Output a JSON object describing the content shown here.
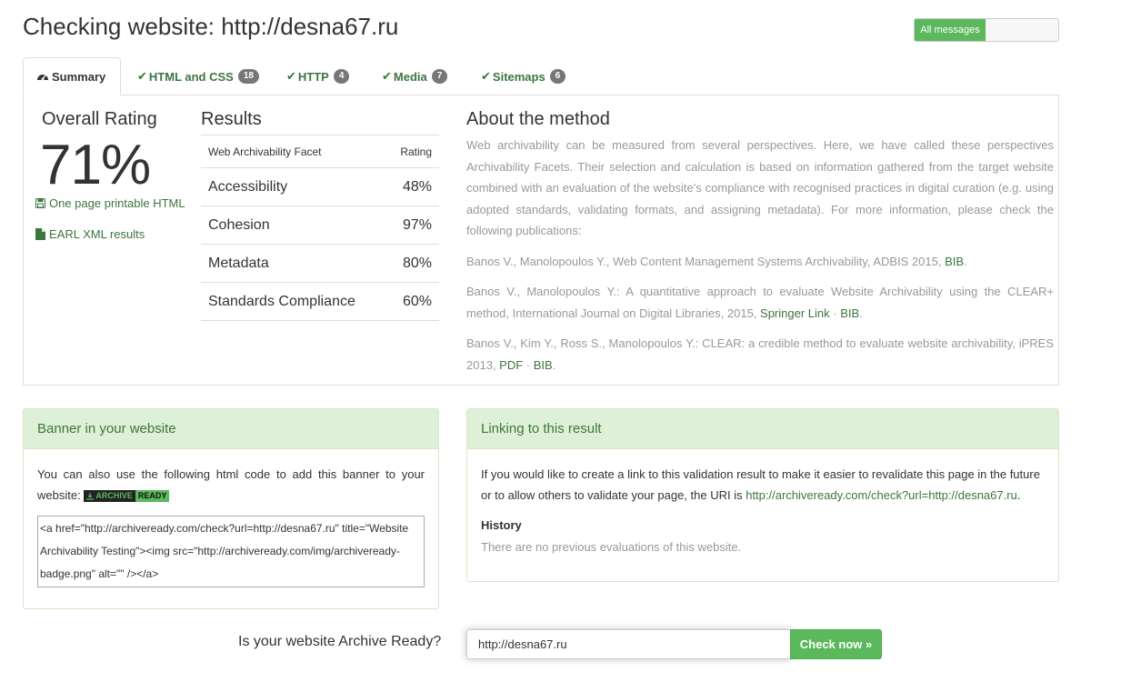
{
  "header": {
    "title": "Checking website: http://desna67.ru",
    "toggle_label": "All messages"
  },
  "tabs": [
    {
      "label": "Summary",
      "icon": "dashboard-icon",
      "active": true
    },
    {
      "label": "HTML and CSS",
      "icon": "check-icon",
      "count": "18"
    },
    {
      "label": "HTTP",
      "icon": "check-icon",
      "count": "4"
    },
    {
      "label": "Media",
      "icon": "check-icon",
      "count": "7"
    },
    {
      "label": "Sitemaps",
      "icon": "check-icon",
      "count": "6"
    }
  ],
  "overall": {
    "title": "Overall Rating",
    "value": "71%",
    "printable_link": "One page printable HTML",
    "earl_link": "EARL XML results"
  },
  "results": {
    "title": "Results",
    "col_facet": "Web Archivability Facet",
    "col_rating": "Rating",
    "rows": [
      {
        "facet": "Accessibility",
        "rating": "48%"
      },
      {
        "facet": "Cohesion",
        "rating": "97%"
      },
      {
        "facet": "Metadata",
        "rating": "80%"
      },
      {
        "facet": "Standards Compliance",
        "rating": "60%"
      }
    ]
  },
  "about": {
    "title": "About the method",
    "intro": "Web archivability can be measured from several perspectives. Here, we have called these perspectives Archivability Facets. Their selection and calculation is based on information gathered from the target website combined with an evaluation of the website's compliance with recognised practices in digital curation (e.g. using adopted standards, validating formats, and assigning metadata). For more information, please check the following publications:",
    "pub1_text": "Banos V., Manolopoulos Y., Web Content Management Systems Archivability, ADBIS 2015, ",
    "pub1_bib": "BIB",
    "pub2_text": "Banos V., Manolopoulos Y.: A quantitative approach to evaluate Website Archivability using the CLEAR+ method, International Journal on Digital Libraries, 2015, ",
    "pub2_link1": "Springer Link",
    "pub2_link2": "BIB",
    "pub3_text": "Banos V., Kim Y., Ross S., Manolopoulos Y.: CLEAR: a credible method to evaluate website archivability, iPRES 2013, ",
    "pub3_link1": "PDF",
    "pub3_link2": "BIB",
    "separator": " · ",
    "period": "."
  },
  "banner": {
    "heading": "Banner in your website",
    "text": "You can also use the following html code to add this banner to your website:",
    "badge_left": "ARCHIVE",
    "badge_right": "READY",
    "code": "<a href=\"http://archiveready.com/check?url=http://desna67.ru\" title=\"Website Archivability Testing\"><img src=\"http://archiveready.com/img/archiveready-badge.png\" alt=\"\" /></a>"
  },
  "linking": {
    "heading": "Linking to this result",
    "text": "If you would like to create a link to this validation result to make it easier to revalidate this page in the future or to allow others to validate your page, the URI is ",
    "uri": "http://archiveready.com/check?url=http://desna67.ru",
    "period": ".",
    "history_title": "History",
    "history_text": "There are no previous evaluations of this website."
  },
  "form": {
    "question": "Is your website Archive Ready?",
    "url_value": "http://desna67.ru",
    "button_label": "Check now »"
  },
  "colors": {
    "accent": "#5cb85c",
    "link": "#3c763d",
    "panel_heading_bg": "#dff0d8"
  }
}
